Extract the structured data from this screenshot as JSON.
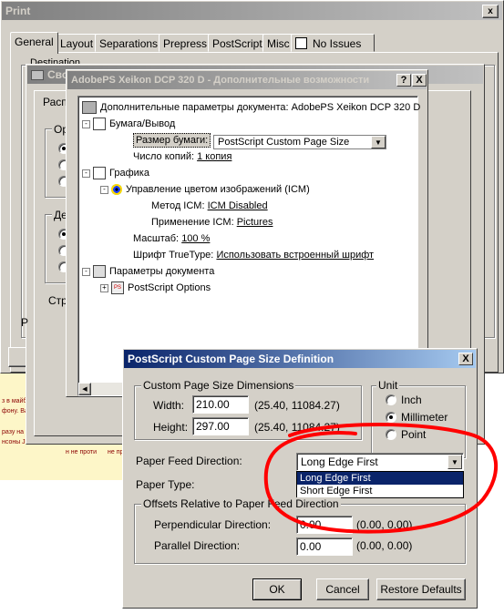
{
  "print_window": {
    "title": "Print",
    "tabs": [
      "General",
      "Layout",
      "Separations",
      "Prepress",
      "PostScript",
      "Misc",
      "No Issues"
    ],
    "active_tab": "General",
    "destination_label": "Destination",
    "bg_labels": [
      "Распо",
      "Ор",
      "Де",
      "Стра",
      "Р"
    ]
  },
  "props_window": {
    "title": "Сво"
  },
  "advanced_window": {
    "title": "AdobePS Xeikon DCP 320 D - Дополнительные возможности",
    "help_btn": "?",
    "close_btn": "X",
    "tree": {
      "root": "Дополнительные параметры документа: AdobePS Xeikon DCP 320 D",
      "paper_output": "Бумага/Вывод",
      "paper_size_label": "Размер бумаги:",
      "paper_size_value": "PostScript Custom Page Size",
      "copies_label": "Число копий:",
      "copies_value": "1 копия",
      "graphics": "Графика",
      "icm": "Управление цветом изображений (ICM)",
      "icm_method_label": "Метод ICM:",
      "icm_method_value": "ICM Disabled",
      "icm_apply_label": "Применение ICM:",
      "icm_apply_value": "Pictures",
      "scale_label": "Масштаб:",
      "scale_value": "100 %",
      "truetype_label": "Шрифт TrueType:",
      "truetype_value": "Использовать встроенный шрифт",
      "doc_params": "Параметры документа",
      "ps_options": "PostScript Options"
    }
  },
  "bg_document": {
    "texts": [
      "з в майбу",
      "фону. Ваш",
      "разу на ви",
      "нсоны John",
      "н не проти",
      "не пр"
    ]
  },
  "dialog": {
    "title": "PostScript Custom Page Size Definition",
    "close_btn": "X",
    "dims_group": "Custom Page Size Dimensions",
    "width_label": "Width:",
    "width_value": "210.00",
    "width_range": "(25.40, 11084.27)",
    "height_label": "Height:",
    "height_value": "297.00",
    "height_range": "(25.40, 11084.27)",
    "unit_group": "Unit",
    "units": [
      {
        "label": "Inch",
        "selected": false
      },
      {
        "label": "Millimeter",
        "selected": true
      },
      {
        "label": "Point",
        "selected": false
      }
    ],
    "feed_label": "Paper Feed Direction:",
    "feed_value": "Long Edge First",
    "feed_options": [
      "Long Edge First",
      "Short Edge First"
    ],
    "feed_highlighted": "Long Edge First",
    "paper_type_label": "Paper Type:",
    "offsets_group": "Offsets Relative to Paper Feed Direction",
    "perp_label": "Perpendicular Direction:",
    "perp_value": "0.00",
    "perp_range": "(0.00, 0.00)",
    "parallel_label": "Parallel Direction:",
    "parallel_value": "0.00",
    "parallel_range": "(0.00, 0.00)",
    "ok": "OK",
    "cancel": "Cancel",
    "restore": "Restore Defaults"
  },
  "annotation": {
    "color": "#ff0000",
    "shape": "hand-drawn ellipse around Paper Feed Direction dropdown"
  }
}
